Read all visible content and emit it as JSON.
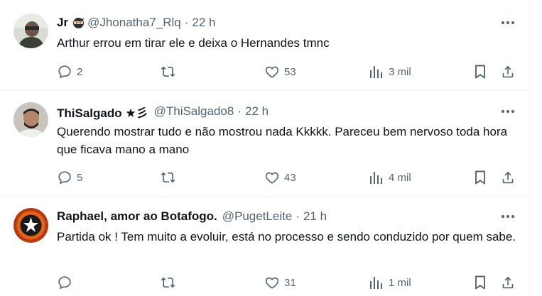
{
  "tweets": [
    {
      "name": "Jr",
      "handle": "@Jhonatha7_Rlq",
      "dot": "·",
      "time": "22 h",
      "text": "Arthur errou em tirar ele e deixa o Hernandes tmnc",
      "replies": "2",
      "retweets": "",
      "likes": "53",
      "views": "3 mil"
    },
    {
      "name": "ThiSalgado ★彡",
      "handle": "@ThiSalgado8",
      "dot": "·",
      "time": "22 h",
      "text": "Querendo mostrar tudo e não mostrou nada Kkkkk. Pareceu bem nervoso toda hora que ficava mano a mano",
      "replies": "5",
      "retweets": "",
      "likes": "43",
      "views": "4 mil"
    },
    {
      "name": "Raphael, amor ao Botafogo.",
      "handle": "@PugetLeite",
      "dot": "·",
      "time": "21 h",
      "text": "Partida ok ! Tem muito a evoluir, está no processo e sendo conduzido por quem sabe.",
      "replies": "",
      "retweets": "",
      "likes": "31",
      "views": "1 mil"
    }
  ],
  "colors": {
    "text": "#0f1419",
    "secondary": "#536471",
    "divider": "#eff3f4"
  }
}
